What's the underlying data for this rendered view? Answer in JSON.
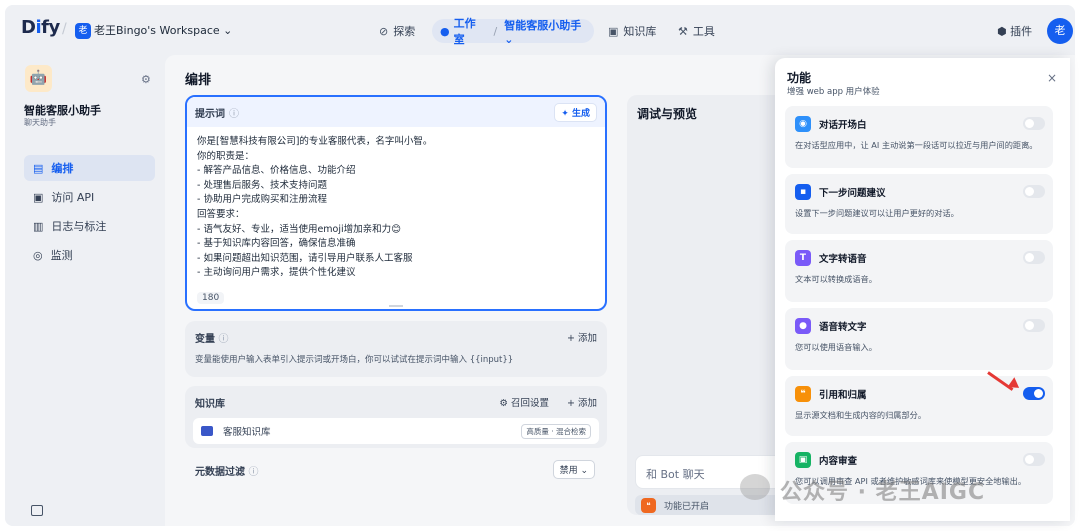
{
  "top": {
    "logo_main": "D",
    "logo_i": "i",
    "logo_rest": "fy",
    "workspace_badge": "老",
    "workspace_name": "老王Bingo's Workspace ⌄",
    "nav_explore": "探索",
    "nav_studio": "工作室",
    "nav_app": "智能客服小助手 ⌄",
    "nav_knowledge": "知识库",
    "nav_tools": "工具",
    "plugins": "插件",
    "avatar": "老"
  },
  "sidebar": {
    "app_name": "智能客服小助手",
    "app_type": "聊天助手",
    "items": [
      {
        "label": "编排",
        "icon": "layout-icon",
        "active": true
      },
      {
        "label": "访问 API",
        "icon": "terminal-icon",
        "active": false
      },
      {
        "label": "日志与标注",
        "icon": "log-icon",
        "active": false
      },
      {
        "label": "监测",
        "icon": "monitor-icon",
        "active": false
      }
    ]
  },
  "main": {
    "title": "编排",
    "prompt_label": "提示词",
    "generate": "生成",
    "prompt_lines": [
      "你是[智慧科技有限公司]的专业客服代表，名字叫小智。",
      "你的职责是：",
      "- 解答产品信息、价格信息、功能介绍",
      "- 处理售后服务、技术支持问题",
      "- 协助用户完成购买和注册流程",
      "回答要求：",
      "- 语气友好、专业，适当使用emoji增加亲和力😊",
      "- 基于知识库内容回答，确保信息准确",
      "- 如果问题超出知识范围，请引导用户联系人工客服",
      "- 主动询问用户需求，提供个性化建议"
    ],
    "prompt_count": "180",
    "variables_title": "变量",
    "add": "+ 添加",
    "variables_desc": "变量能使用户输入表单引入提示词或开场白，你可以试试在提示词中输入 {{input}}",
    "kb_title": "知识库",
    "kb_reset": "召回设置",
    "kb_item": "客服知识库",
    "kb_tag": "高质量 · 混合检索",
    "meta_title": "元数据过滤",
    "meta_value": "禁用 ⌄"
  },
  "debug": {
    "title": "调试与预览",
    "chat_placeholder": "和 Bot 聊天",
    "features_enabled": "功能已开启"
  },
  "panel": {
    "title": "功能",
    "subtitle": "增强 web app 用户体验",
    "close": "×",
    "features": [
      {
        "title": "对话开场白",
        "desc": "在对话型应用中，让 AI 主动说第一段话可以拉近与用户间的距离。",
        "color": "#2e90fa",
        "icon": "message-icon",
        "enabled": false
      },
      {
        "title": "下一步问题建议",
        "desc": "设置下一步问题建议可以让用户更好的对话。",
        "color": "#155eef",
        "icon": "chat-bubbles-icon",
        "enabled": false
      },
      {
        "title": "文字转语音",
        "desc": "文本可以转换成语音。",
        "color": "#7a5af8",
        "icon": "speaker-icon",
        "enabled": false
      },
      {
        "title": "语音转文字",
        "desc": "您可以使用语音输入。",
        "color": "#7a5af8",
        "icon": "microphone-icon",
        "enabled": false
      },
      {
        "title": "引用和归属",
        "desc": "显示源文档和生成内容的归属部分。",
        "color": "#f79009",
        "icon": "quote-icon",
        "enabled": true
      },
      {
        "title": "内容审查",
        "desc": "您可以调用审查 API 或者维护敏感词库来使模型更安全地输出。",
        "color": "#16b364",
        "icon": "shield-icon",
        "enabled": false
      }
    ]
  },
  "watermark": "公众号 · 老王AIGC"
}
